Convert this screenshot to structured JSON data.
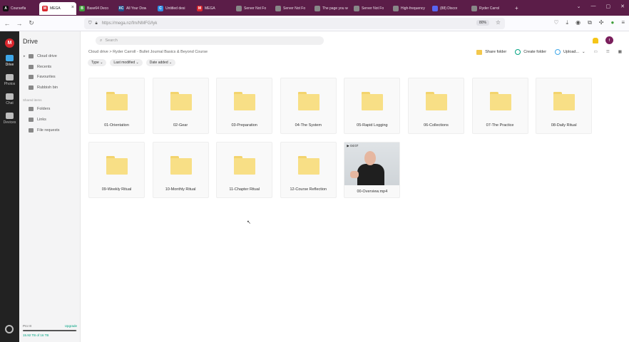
{
  "browser": {
    "tabs": [
      {
        "label": "Coursefla",
        "fav_color": "#111111",
        "fav_glyph": "A",
        "active": false
      },
      {
        "label": "MEGA",
        "fav_color": "#d9272e",
        "fav_glyph": "M",
        "active": true
      },
      {
        "label": "Base64 Deco",
        "fav_color": "#3f9e3a",
        "fav_glyph": "B",
        "active": false
      },
      {
        "label": "All Your Dow",
        "fav_color": "#1d4e89",
        "fav_glyph": "XC",
        "active": false
      },
      {
        "label": "Untitled desi",
        "fav_color": "#2d8de4",
        "fav_glyph": "C",
        "active": false
      },
      {
        "label": "MEGA",
        "fav_color": "#d9272e",
        "fav_glyph": "M",
        "active": false
      },
      {
        "label": "Server Not Fo",
        "fav_color": "#888888",
        "fav_glyph": "",
        "active": false
      },
      {
        "label": "Server Not Fo",
        "fav_color": "#888888",
        "fav_glyph": "",
        "active": false
      },
      {
        "label": "The page you were",
        "fav_color": "#888888",
        "fav_glyph": "",
        "active": false
      },
      {
        "label": "Server Not Fo",
        "fav_color": "#888888",
        "fav_glyph": "",
        "active": false
      },
      {
        "label": "High-frequency",
        "fav_color": "#888888",
        "fav_glyph": "",
        "active": false
      },
      {
        "label": "(88) Discor",
        "fav_color": "#5865f2",
        "fav_glyph": "",
        "active": false
      },
      {
        "label": "Ryder Carrol",
        "fav_color": "#888888",
        "fav_glyph": "",
        "active": false
      }
    ],
    "url": "https://mega.nz/fm/NMFG/lyk",
    "zoom": "80%"
  },
  "rail": {
    "logo": "M",
    "items": [
      {
        "label": "Drive",
        "active": true
      },
      {
        "label": "Photos",
        "active": false
      },
      {
        "label": "Chat",
        "active": false
      },
      {
        "label": "Devices",
        "active": false
      }
    ]
  },
  "sidebar": {
    "title": "Drive",
    "items": [
      {
        "label": "Cloud drive"
      },
      {
        "label": "Recents"
      },
      {
        "label": "Favourites"
      },
      {
        "label": "Rubbish bin"
      }
    ],
    "section_label": "Shared items",
    "shared_items": [
      {
        "label": "Folders"
      },
      {
        "label": "Links"
      },
      {
        "label": "File requests"
      }
    ],
    "plan": {
      "name": "Pro III",
      "upgrade": "Upgrade",
      "used_text": "15.92 TB of 16 TB",
      "used_fraction": 0.99
    }
  },
  "main": {
    "search_placeholder": "Search",
    "avatar_initial": "f",
    "breadcrumb": "Cloud drive  >  Ryder Carroll - Bullet Journal Basics & Beyond Course",
    "toolbar": {
      "share_folder": "Share folder",
      "create_folder": "Create folder",
      "upload": "Upload..."
    },
    "filters": [
      "Type ⌄",
      "Last modified ⌄",
      "Date added ⌄"
    ],
    "items": [
      {
        "name": "01-Orientation",
        "kind": "folder"
      },
      {
        "name": "02-Gear",
        "kind": "folder"
      },
      {
        "name": "03-Preparation",
        "kind": "folder"
      },
      {
        "name": "04-The System",
        "kind": "folder"
      },
      {
        "name": "05-Rapid Logging",
        "kind": "folder"
      },
      {
        "name": "06-Collections",
        "kind": "folder"
      },
      {
        "name": "07-The Practice",
        "kind": "folder"
      },
      {
        "name": "08-Daily Ritual",
        "kind": "folder"
      },
      {
        "name": "09-Weekly Ritual",
        "kind": "folder"
      },
      {
        "name": "10-Monthly Ritual",
        "kind": "folder"
      },
      {
        "name": "11-Chapter Ritual",
        "kind": "folder"
      },
      {
        "name": "12-Course Reflection",
        "kind": "folder"
      },
      {
        "name": "00-Overview.mp4",
        "kind": "video",
        "duration": "▶ 04:07"
      }
    ]
  }
}
